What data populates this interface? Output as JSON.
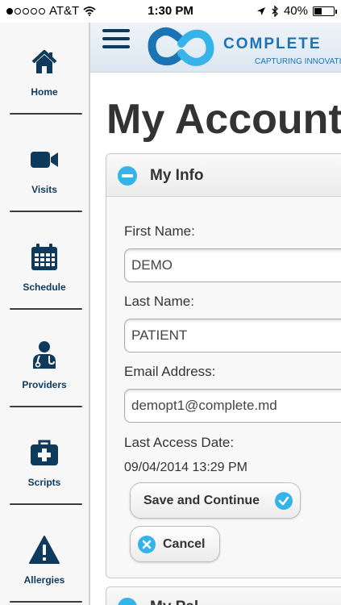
{
  "status_bar": {
    "carrier": "AT&T",
    "time": "1:30 PM",
    "battery": "40%",
    "battery_level": 0.4
  },
  "sidebar": {
    "items": [
      {
        "label": "Home",
        "icon": "home-icon"
      },
      {
        "label": "Visits",
        "icon": "video-camera-icon"
      },
      {
        "label": "Schedule",
        "icon": "calendar-icon"
      },
      {
        "label": "Providers",
        "icon": "doctor-icon"
      },
      {
        "label": "Scripts",
        "icon": "medical-kit-icon"
      },
      {
        "label": "Allergies",
        "icon": "warning-icon"
      }
    ]
  },
  "header": {
    "brand": "COMPLETE",
    "tagline": "CAPTURING INNOVATION"
  },
  "page": {
    "title": "My Account"
  },
  "my_info": {
    "title": "My Info",
    "first_name_label": "First Name:",
    "first_name_value": "DEMO",
    "last_name_label": "Last Name:",
    "last_name_value": "PATIENT",
    "email_label": "Email Address:",
    "email_value": "demopt1@complete.md",
    "last_access_label": "Last Access Date:",
    "last_access_value": "09/04/2014 13:29 PM",
    "save_label": "Save and Continue",
    "cancel_label": "Cancel"
  },
  "next_section": {
    "title": "My Pal"
  },
  "colors": {
    "navy": "#0e3a5c",
    "accent": "#36b3e8",
    "brand_blue": "#1a73b5"
  }
}
